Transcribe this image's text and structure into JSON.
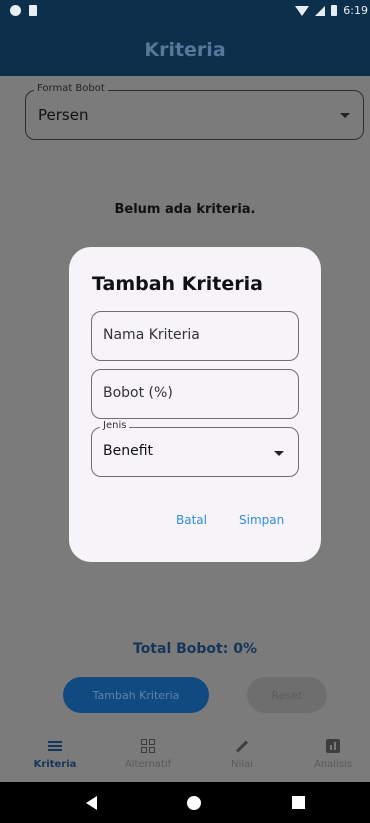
{
  "status_bar": {
    "time": "6:19"
  },
  "app_bar": {
    "title": "Kriteria"
  },
  "format_field": {
    "label": "Format Bobot",
    "value": "Persen"
  },
  "empty_message": "Belum ada kriteria.",
  "total_bobot": "Total Bobot: 0%",
  "buttons": {
    "tambah": "Tambah Kriteria",
    "reset": "Reset"
  },
  "bottom_nav": [
    {
      "label": "Kriteria",
      "icon": "list-icon",
      "active": true
    },
    {
      "label": "Alternatif",
      "icon": "grid-icon",
      "active": false
    },
    {
      "label": "Nilai",
      "icon": "pencil-icon",
      "active": false
    },
    {
      "label": "Analisis",
      "icon": "chart-icon",
      "active": false
    }
  ],
  "dialog": {
    "title": "Tambah Kriteria",
    "nama_placeholder": "Nama Kriteria",
    "bobot_placeholder": "Bobot (%)",
    "jenis_label": "Jenis",
    "jenis_value": "Benefit",
    "cancel_label": "Batal",
    "save_label": "Simpan"
  },
  "colors": {
    "app_bar": "#0c2f4c",
    "accent": "#2f8ee3",
    "scrim": "#7b7b7b",
    "dialog_bg": "#f6f3f9"
  }
}
